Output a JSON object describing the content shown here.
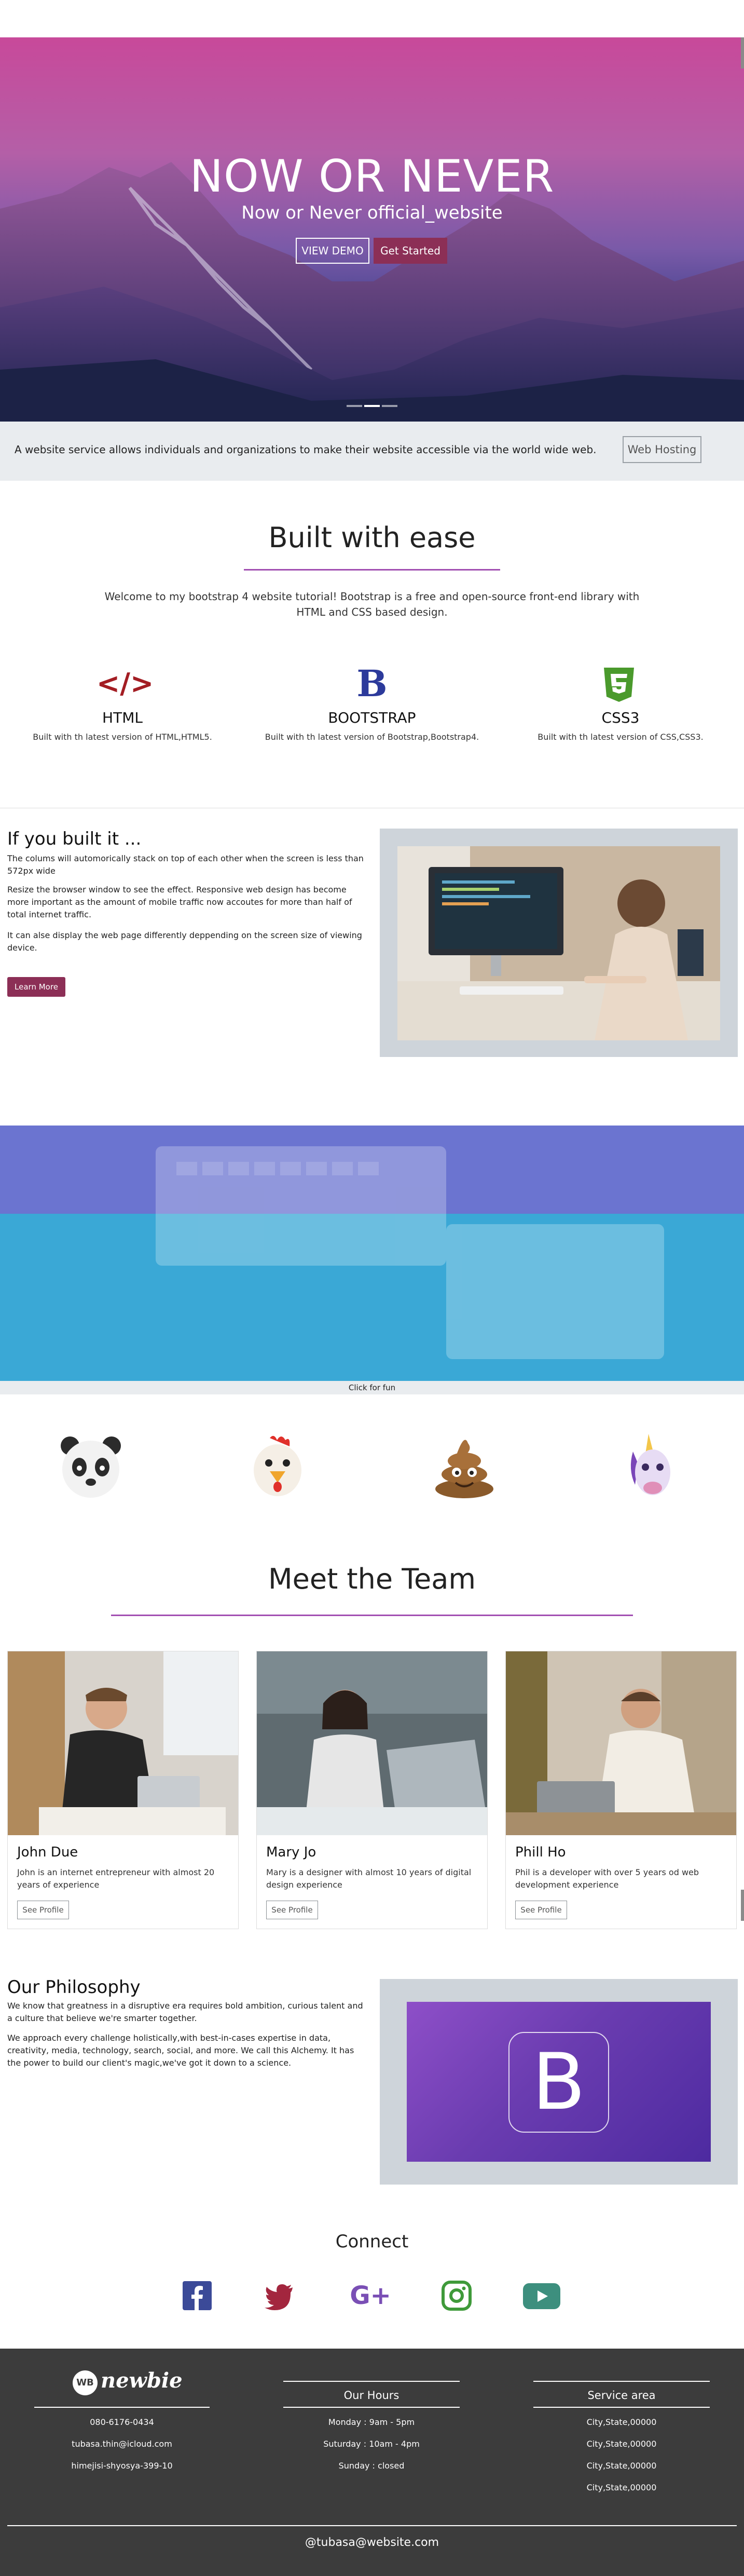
{
  "hero": {
    "title": "NOW OR NEVER",
    "subtitle": "Now or Never official_website",
    "btn_demo": "VIEW DEMO",
    "btn_start": "Get Started"
  },
  "banner": {
    "text": "A website service allows individuals and organizations to make their website accessible via the world wide web.",
    "button": "Web Hosting"
  },
  "ease": {
    "title": "Built with ease",
    "text": "Welcome to my bootstrap 4 website tutorial! Bootstrap is a free and open-source front-end library with HTML and CSS based design.",
    "features": [
      {
        "icon": "html5-code-icon",
        "glyph": "</>",
        "color": "#a31d23",
        "title": "HTML",
        "text": "Built with th latest version of HTML,HTML5."
      },
      {
        "icon": "bootstrap-icon",
        "glyph": "B",
        "color": "#2c3a9b",
        "title": "BOOTSTRAP",
        "text": "Built with th latest version of Bootstrap,Bootstrap4."
      },
      {
        "icon": "css3-icon",
        "glyph": "3",
        "color": "#4a9a2c",
        "title": "CSS3",
        "text": "Built with th latest version of CSS,CSS3."
      }
    ]
  },
  "built": {
    "title": "If you built it ...",
    "paragraphs": [
      "The colums will automorically stack on top of each other when the screen is less than 572px wide",
      "Resize the browser window to see the effect. Responsive web design has become more important as the amount of mobile traffic now accoutes for more than half of total internet traffic.",
      "It can alse display the web page differently deppending on the screen size of viewing device."
    ],
    "button": "Learn More"
  },
  "fun": {
    "label": "Click for fun",
    "emojis": [
      "panda-emoji",
      "chicken-emoji",
      "poop-emoji",
      "unicorn-emoji"
    ]
  },
  "team": {
    "title": "Meet the Team",
    "members": [
      {
        "name": "John Due",
        "text": "John is an internet entrepreneur with almost 20 years of experience",
        "button": "See Profile"
      },
      {
        "name": "Mary Jo",
        "text": "Mary is a designer with almost 10 years of digital design experience",
        "button": "See Profile"
      },
      {
        "name": "Phill Ho",
        "text": "Phil is a developer with over 5 years od web development experience",
        "button": "See Profile"
      }
    ]
  },
  "philosophy": {
    "title": "Our Philosophy",
    "paragraphs": [
      "We know that greatness in a disruptive era requires bold ambition, curious talent and a culture that believe we're smarter together.",
      "We approach every challenge holistically,with best-in-cases expertise in data, creativity, media, technology, search, social, and more. We call this Alchemy. It has the power to build our client's magic,we've got it down to a science."
    ]
  },
  "connect": {
    "title": "Connect",
    "icons": [
      {
        "name": "facebook-icon",
        "color": "#3b4a98"
      },
      {
        "name": "twitter-icon",
        "color": "#a3263e"
      },
      {
        "name": "google-plus-icon",
        "color": "#7a4fb5"
      },
      {
        "name": "instagram-icon",
        "color": "#3f9a3a"
      },
      {
        "name": "youtube-icon",
        "color": "#3d8f7e"
      }
    ]
  },
  "footer": {
    "logo": "newbie",
    "logo_mark": "WB",
    "contact": [
      "080-6176-0434",
      "tubasa.thin@icloud.com",
      "himejisi-shyosya-399-10"
    ],
    "hours_title": "Our Hours",
    "hours": [
      "Monday : 9am - 5pm",
      "Suturday : 10am - 4pm",
      "Sunday : closed"
    ],
    "area_title": "Service area",
    "areas": [
      "City,State,00000",
      "City,State,00000",
      "City,State,00000",
      "City,State,00000"
    ],
    "copyright": "@tubasa@website.com"
  }
}
